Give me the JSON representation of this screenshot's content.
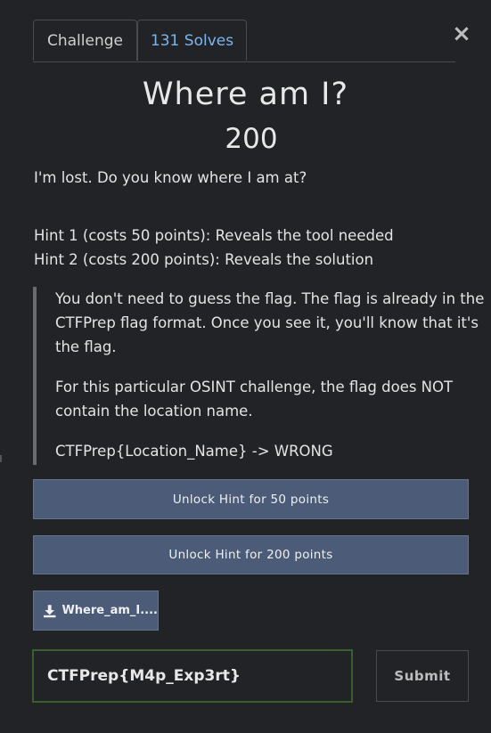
{
  "tabs": [
    {
      "label": "Challenge"
    },
    {
      "label": "131 Solves"
    }
  ],
  "close_symbol": "×",
  "challenge": {
    "name": "Where am I?",
    "value": "200",
    "description": "I'm lost. Do you know where I am at?"
  },
  "hints": [
    "Hint 1 (costs 50 points): Reveals the tool needed",
    "Hint 2 (costs 200 points): Reveals the solution"
  ],
  "notice": {
    "line1": "You don't need to guess the flag. The flag is already in the",
    "line2": "CTFPrep flag format. Once you see it, you'll know that it's",
    "line3": "the flag.",
    "line4": "For this particular OSINT challenge, the flag does NOT",
    "line5": "contain the location name.",
    "line6": "CTFPrep{Location_Name} -> WRONG"
  },
  "buttons": {
    "unlock_hint_1": "Unlock Hint for 50 points",
    "unlock_hint_2": "Unlock Hint for 200 points",
    "file": "Where_am_I....",
    "submit": "Submit"
  },
  "flag_input": {
    "value": "CTFPrep{M4p_Exp3rt}"
  },
  "icons": {
    "close": "close-icon",
    "download": "download-icon"
  },
  "colors": {
    "background": "#222326",
    "button": "#4b5b78",
    "active_tab": "#7cb5ec",
    "input_border": "#3a5f2f"
  }
}
